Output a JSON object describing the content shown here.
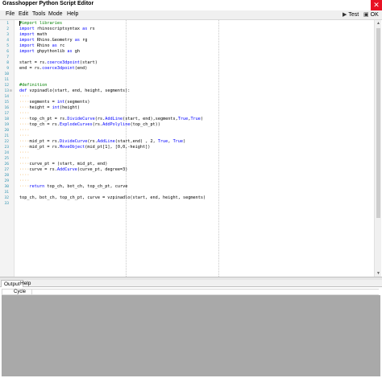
{
  "window": {
    "title": "Grasshopper Python Script Editor",
    "close_glyph": "✕"
  },
  "menu": [
    {
      "label": "File"
    },
    {
      "label": "Edit"
    },
    {
      "label": "Tools"
    },
    {
      "label": "Mode"
    },
    {
      "label": "Help"
    }
  ],
  "toolbar": {
    "test_label": "Test",
    "ok_label": "OK",
    "test_icon": "play-icon",
    "ok_icon": "save-ok-icon"
  },
  "editor": {
    "line_count_visible": 33,
    "lines": [
      {
        "n": "1",
        "fold": "",
        "indent": "",
        "segs": [
          {
            "t": "#import libraries",
            "c": "cm"
          }
        ]
      },
      {
        "n": "2",
        "fold": "",
        "indent": "",
        "segs": [
          {
            "t": "import",
            "c": "kw"
          },
          {
            "t": " rhinoscriptsyntax ",
            "c": "pu"
          },
          {
            "t": "as",
            "c": "kw"
          },
          {
            "t": " rs",
            "c": "pu"
          }
        ]
      },
      {
        "n": "3",
        "fold": "",
        "indent": "",
        "segs": [
          {
            "t": "import",
            "c": "kw"
          },
          {
            "t": " math",
            "c": "pu"
          }
        ]
      },
      {
        "n": "4",
        "fold": "",
        "indent": "",
        "segs": [
          {
            "t": "import",
            "c": "kw"
          },
          {
            "t": " Rhino.Geometry ",
            "c": "pu"
          },
          {
            "t": "as",
            "c": "kw"
          },
          {
            "t": " rg",
            "c": "pu"
          }
        ]
      },
      {
        "n": "5",
        "fold": "",
        "indent": "",
        "segs": [
          {
            "t": "import",
            "c": "kw"
          },
          {
            "t": " Rhino ",
            "c": "pu"
          },
          {
            "t": "as",
            "c": "kw"
          },
          {
            "t": " rc",
            "c": "pu"
          }
        ]
      },
      {
        "n": "6",
        "fold": "",
        "indent": "",
        "segs": [
          {
            "t": "import",
            "c": "kw"
          },
          {
            "t": " ghpythonlib ",
            "c": "pu"
          },
          {
            "t": "as",
            "c": "kw"
          },
          {
            "t": " gh",
            "c": "pu"
          }
        ]
      },
      {
        "n": "7",
        "fold": "",
        "indent": "",
        "segs": []
      },
      {
        "n": "8",
        "fold": "",
        "indent": "",
        "segs": [
          {
            "t": "start = rs.",
            "c": "pu"
          },
          {
            "t": "coerce3dpoint",
            "c": "kw"
          },
          {
            "t": "(start)",
            "c": "pu"
          }
        ]
      },
      {
        "n": "9",
        "fold": "",
        "indent": "",
        "segs": [
          {
            "t": "end = rs.",
            "c": "pu"
          },
          {
            "t": "coerce3dpoint",
            "c": "kw"
          },
          {
            "t": "(end)",
            "c": "pu"
          }
        ]
      },
      {
        "n": "10",
        "fold": "",
        "indent": "",
        "segs": []
      },
      {
        "n": "11",
        "fold": "",
        "indent": "",
        "segs": []
      },
      {
        "n": "12",
        "fold": "",
        "indent": "",
        "segs": [
          {
            "t": "#definition",
            "c": "cm"
          }
        ]
      },
      {
        "n": "13",
        "fold": "⊟",
        "indent": "",
        "segs": [
          {
            "t": "def",
            "c": "kw"
          },
          {
            "t": " vzpinadlo(start, end, height, segments):",
            "c": "pu"
          }
        ]
      },
      {
        "n": "14",
        "fold": "",
        "indent": "····",
        "segs": []
      },
      {
        "n": "15",
        "fold": "",
        "indent": "····",
        "segs": [
          {
            "t": "segments = ",
            "c": "pu"
          },
          {
            "t": "int",
            "c": "kw"
          },
          {
            "t": "(segments)",
            "c": "pu"
          }
        ]
      },
      {
        "n": "16",
        "fold": "",
        "indent": "····",
        "segs": [
          {
            "t": "height = ",
            "c": "pu"
          },
          {
            "t": "int",
            "c": "kw"
          },
          {
            "t": "(height)",
            "c": "pu"
          }
        ]
      },
      {
        "n": "17",
        "fold": "",
        "indent": "····",
        "segs": []
      },
      {
        "n": "18",
        "fold": "",
        "indent": "····",
        "segs": [
          {
            "t": "top_ch_pt = rs.",
            "c": "pu"
          },
          {
            "t": "DivideCurve",
            "c": "kw"
          },
          {
            "t": "(rs.",
            "c": "pu"
          },
          {
            "t": "AddLine",
            "c": "kw"
          },
          {
            "t": "(start, end),segments,",
            "c": "pu"
          },
          {
            "t": "True",
            "c": "kw"
          },
          {
            "t": ",",
            "c": "pu"
          },
          {
            "t": "True",
            "c": "kw"
          },
          {
            "t": ")",
            "c": "pu"
          }
        ]
      },
      {
        "n": "19",
        "fold": "",
        "indent": "····",
        "segs": [
          {
            "t": "top_ch = rs.",
            "c": "pu"
          },
          {
            "t": "ExplodeCurves",
            "c": "kw"
          },
          {
            "t": "(rs.",
            "c": "pu"
          },
          {
            "t": "AddPolyline",
            "c": "kw"
          },
          {
            "t": "(top_ch_pt))",
            "c": "pu"
          }
        ]
      },
      {
        "n": "20",
        "fold": "",
        "indent": "····",
        "segs": []
      },
      {
        "n": "21",
        "fold": "",
        "indent": "····",
        "segs": []
      },
      {
        "n": "22",
        "fold": "",
        "indent": "····",
        "segs": [
          {
            "t": "mid_pt = rs.",
            "c": "pu"
          },
          {
            "t": "DivideCurve",
            "c": "kw"
          },
          {
            "t": "(rs.",
            "c": "pu"
          },
          {
            "t": "AddLine",
            "c": "kw"
          },
          {
            "t": "(start,end) , 2, ",
            "c": "pu"
          },
          {
            "t": "True",
            "c": "kw"
          },
          {
            "t": ", ",
            "c": "pu"
          },
          {
            "t": "True",
            "c": "kw"
          },
          {
            "t": ")",
            "c": "pu"
          }
        ]
      },
      {
        "n": "23",
        "fold": "",
        "indent": "····",
        "segs": [
          {
            "t": "mid_pt = rs.",
            "c": "pu"
          },
          {
            "t": "MoveObject",
            "c": "kw"
          },
          {
            "t": "(mid_pt[1], [0,0,-height])",
            "c": "pu"
          }
        ]
      },
      {
        "n": "24",
        "fold": "",
        "indent": "····",
        "segs": []
      },
      {
        "n": "25",
        "fold": "",
        "indent": "····",
        "segs": []
      },
      {
        "n": "26",
        "fold": "",
        "indent": "····",
        "segs": [
          {
            "t": "curve_pt = (start, mid_pt, end)",
            "c": "pu"
          }
        ]
      },
      {
        "n": "27",
        "fold": "",
        "indent": "····",
        "segs": [
          {
            "t": "curve = rs.",
            "c": "pu"
          },
          {
            "t": "AddCurve",
            "c": "kw"
          },
          {
            "t": "(curve_pt, degree=3)",
            "c": "pu"
          }
        ]
      },
      {
        "n": "28",
        "fold": "",
        "indent": "····",
        "segs": []
      },
      {
        "n": "29",
        "fold": "",
        "indent": "····",
        "segs": []
      },
      {
        "n": "30",
        "fold": "",
        "indent": "····",
        "segs": [
          {
            "t": "return",
            "c": "kw"
          },
          {
            "t": " top_ch, bot_ch, top_ch_pt, curve",
            "c": "pu"
          }
        ]
      },
      {
        "n": "31",
        "fold": "",
        "indent": "",
        "segs": []
      },
      {
        "n": "32",
        "fold": "",
        "indent": "",
        "segs": [
          {
            "t": "top_ch, bot_ch, top_ch_pt, curve = vzpinadlo(start, end, height, segments)",
            "c": "pu"
          }
        ]
      },
      {
        "n": "33",
        "fold": "",
        "indent": "",
        "segs": []
      }
    ]
  },
  "bottom_tabs": [
    {
      "label": "Output"
    },
    {
      "label": "Help"
    }
  ],
  "output": {
    "column_header": "Cycle"
  }
}
